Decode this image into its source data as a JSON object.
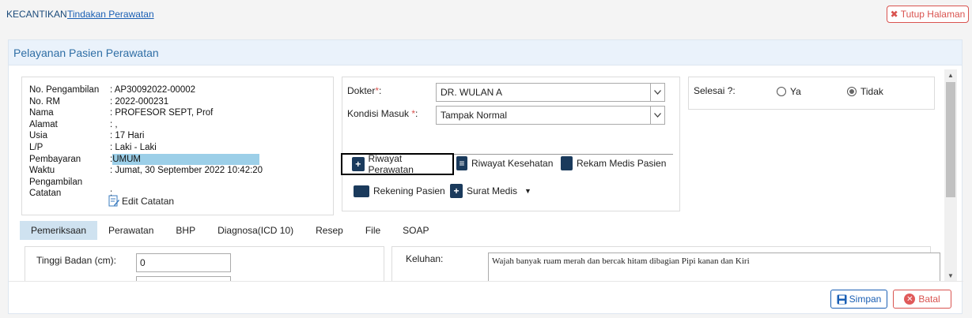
{
  "breadcrumb": {
    "root": "KECANTIKAN",
    "current": "Tindakan Perawatan"
  },
  "close_page": {
    "label": "Tutup Halaman",
    "icon": "x-icon"
  },
  "panel": {
    "title": "Pelayanan Pasien Perawatan"
  },
  "patient": {
    "rows": [
      {
        "label": "No. Pengambilan",
        "value": ": AP30092022-00002"
      },
      {
        "label": "No. RM",
        "value": ": 2022-000231"
      },
      {
        "label": "Nama",
        "value": ": PROFESOR SEPT, Prof"
      },
      {
        "label": "Alamat",
        "value": ": ,"
      },
      {
        "label": "Usia",
        "value": ": 17 Hari"
      },
      {
        "label": "L/P",
        "value": ": Laki - Laki"
      },
      {
        "label": "Pembayaran",
        "value": ":",
        "highlight": "UMUM"
      },
      {
        "label": "Waktu Pengambilan",
        "value": ": Jumat, 30 September 2022 10:42:20"
      },
      {
        "label": "Catatan",
        "value": ":"
      }
    ],
    "edit_note_label": "Edit Catatan"
  },
  "doctor_form": {
    "doctor_label": "Dokter",
    "doctor_value": "DR. WULAN A",
    "condition_label": "Kondisi Masuk ",
    "condition_value": "Tampak Normal",
    "required_mark": "*",
    "colon": ":"
  },
  "actions": {
    "riwayat_perawatan": "Riwayat Perawatan",
    "riwayat_kesehatan": "Riwayat Kesehatan",
    "rekam_medis": "Rekam Medis Pasien",
    "rekening_pasien": "Rekening Pasien",
    "surat_medis": "Surat Medis"
  },
  "done": {
    "label": "Selesai ?:",
    "yes": "Ya",
    "no": "Tidak",
    "selected": "Tidak"
  },
  "tabs": [
    {
      "label": "Pemeriksaan",
      "active": true
    },
    {
      "label": "Perawatan",
      "active": false
    },
    {
      "label": "BHP",
      "active": false
    },
    {
      "label": "Diagnosa(ICD 10)",
      "active": false
    },
    {
      "label": "Resep",
      "active": false
    },
    {
      "label": "File",
      "active": false
    },
    {
      "label": "SOAP",
      "active": false
    }
  ],
  "exam": {
    "height_label": "Tinggi Badan (cm):",
    "height_value": "0"
  },
  "complaint": {
    "label": "Keluhan:",
    "value": "Wajah banyak ruam merah dan bercak hitam dibagian Pipi kanan dan Kiri"
  },
  "footer": {
    "save_label": "Simpan",
    "cancel_label": "Batal"
  }
}
